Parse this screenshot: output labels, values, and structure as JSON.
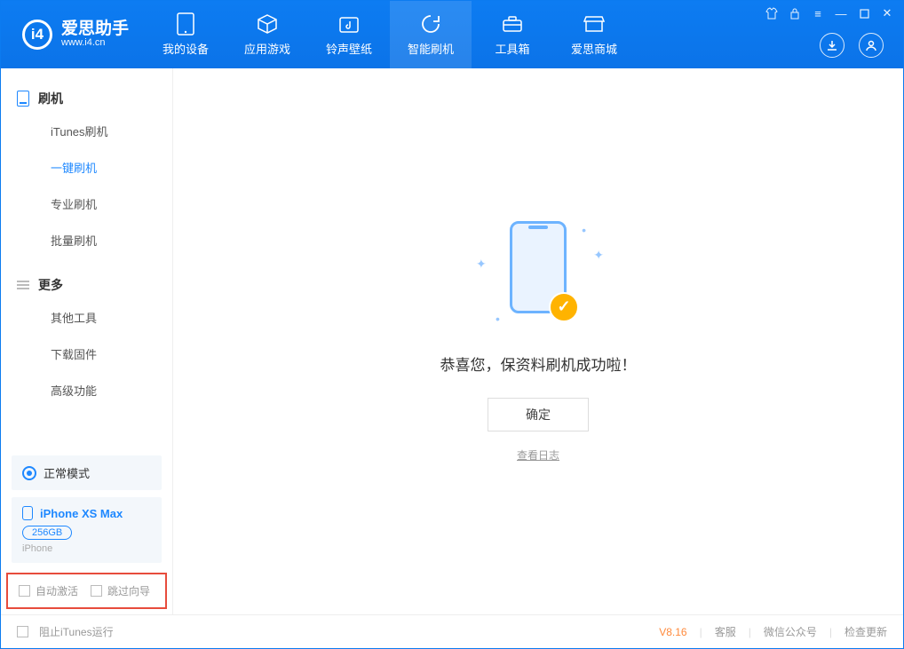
{
  "app": {
    "name": "爱思助手",
    "url": "www.i4.cn"
  },
  "nav": {
    "tabs": [
      {
        "label": "我的设备"
      },
      {
        "label": "应用游戏"
      },
      {
        "label": "铃声壁纸"
      },
      {
        "label": "智能刷机"
      },
      {
        "label": "工具箱"
      },
      {
        "label": "爱思商城"
      }
    ],
    "active_index": 3
  },
  "sidebar": {
    "group1": {
      "title": "刷机"
    },
    "group1_items": [
      {
        "label": "iTunes刷机"
      },
      {
        "label": "一键刷机"
      },
      {
        "label": "专业刷机"
      },
      {
        "label": "批量刷机"
      }
    ],
    "group1_active_index": 1,
    "group2": {
      "title": "更多"
    },
    "group2_items": [
      {
        "label": "其他工具"
      },
      {
        "label": "下载固件"
      },
      {
        "label": "高级功能"
      }
    ],
    "mode_label": "正常模式",
    "device": {
      "name": "iPhone XS Max",
      "capacity": "256GB",
      "type": "iPhone"
    },
    "checks": {
      "auto_activate": "自动激活",
      "skip_guide": "跳过向导"
    }
  },
  "main": {
    "success_text": "恭喜您，保资料刷机成功啦！",
    "ok_button": "确定",
    "view_log": "查看日志"
  },
  "footer": {
    "block_itunes": "阻止iTunes运行",
    "version": "V8.16",
    "links": {
      "support": "客服",
      "wechat": "微信公众号",
      "check_update": "检查更新"
    }
  }
}
